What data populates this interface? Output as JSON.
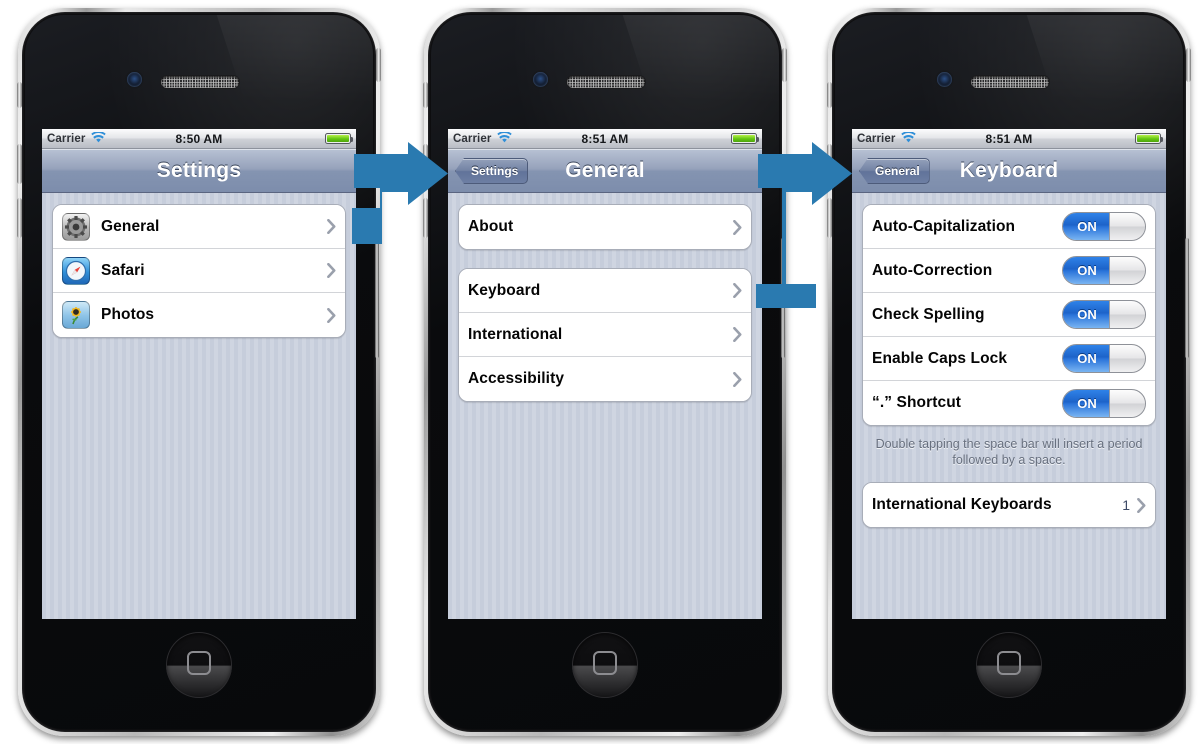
{
  "accent": {
    "arrow_blue": "#2a7ab0",
    "toggle_blue": "#1d63c9",
    "navbar_blue": "#8494b1"
  },
  "phones": [
    {
      "name": "settings-phone",
      "statusbar": {
        "carrier": "Carrier",
        "wifi_icon": "wifi-icon",
        "time": "8:50 AM",
        "battery_icon": "battery-icon"
      },
      "navbar": {
        "title": "Settings",
        "back": null
      },
      "groups": [
        {
          "rows": [
            {
              "icon": "settings-gear-icon",
              "label": "General",
              "value": "",
              "accessory": "chevron-right-icon"
            },
            {
              "icon": "safari-compass-icon",
              "label": "Safari",
              "value": "",
              "accessory": "chevron-right-icon"
            },
            {
              "icon": "photos-sunflower-icon",
              "label": "Photos",
              "value": "",
              "accessory": "chevron-right-icon"
            }
          ]
        }
      ],
      "footnote": ""
    },
    {
      "name": "general-phone",
      "statusbar": {
        "carrier": "Carrier",
        "wifi_icon": "wifi-icon",
        "time": "8:51 AM",
        "battery_icon": "battery-icon"
      },
      "navbar": {
        "title": "General",
        "back": "Settings"
      },
      "groups": [
        {
          "rows": [
            {
              "icon": "",
              "label": "About",
              "value": "",
              "accessory": "chevron-right-icon"
            }
          ]
        },
        {
          "rows": [
            {
              "icon": "",
              "label": "Keyboard",
              "value": "",
              "accessory": "chevron-right-icon"
            },
            {
              "icon": "",
              "label": "International",
              "value": "",
              "accessory": "chevron-right-icon"
            },
            {
              "icon": "",
              "label": "Accessibility",
              "value": "",
              "accessory": "chevron-right-icon"
            }
          ]
        }
      ],
      "footnote": ""
    },
    {
      "name": "keyboard-phone",
      "statusbar": {
        "carrier": "Carrier",
        "wifi_icon": "wifi-icon",
        "time": "8:51 AM",
        "battery_icon": "battery-icon"
      },
      "navbar": {
        "title": "Keyboard",
        "back": "General"
      },
      "groups": [
        {
          "rows": [
            {
              "icon": "",
              "label": "Auto-Capitalization",
              "value": "",
              "accessory": "toggle-switch",
              "toggle": "ON"
            },
            {
              "icon": "",
              "label": "Auto-Correction",
              "value": "",
              "accessory": "toggle-switch",
              "toggle": "ON"
            },
            {
              "icon": "",
              "label": "Check Spelling",
              "value": "",
              "accessory": "toggle-switch",
              "toggle": "ON"
            },
            {
              "icon": "",
              "label": "Enable Caps Lock",
              "value": "",
              "accessory": "toggle-switch",
              "toggle": "ON"
            },
            {
              "icon": "",
              "label": "“.” Shortcut",
              "value": "",
              "accessory": "toggle-switch",
              "toggle": "ON"
            }
          ]
        },
        {
          "rows": [
            {
              "icon": "",
              "label": "International Keyboards",
              "value": "1",
              "accessory": "chevron-right-icon"
            }
          ]
        }
      ],
      "footnote": "Double tapping the space bar will insert a period followed by a space."
    }
  ],
  "arrows": [
    {
      "name": "arrow-settings-to-general",
      "from": "General row",
      "to": "General screen"
    },
    {
      "name": "arrow-general-to-keyboard",
      "from": "Keyboard row",
      "to": "Keyboard screen"
    }
  ]
}
